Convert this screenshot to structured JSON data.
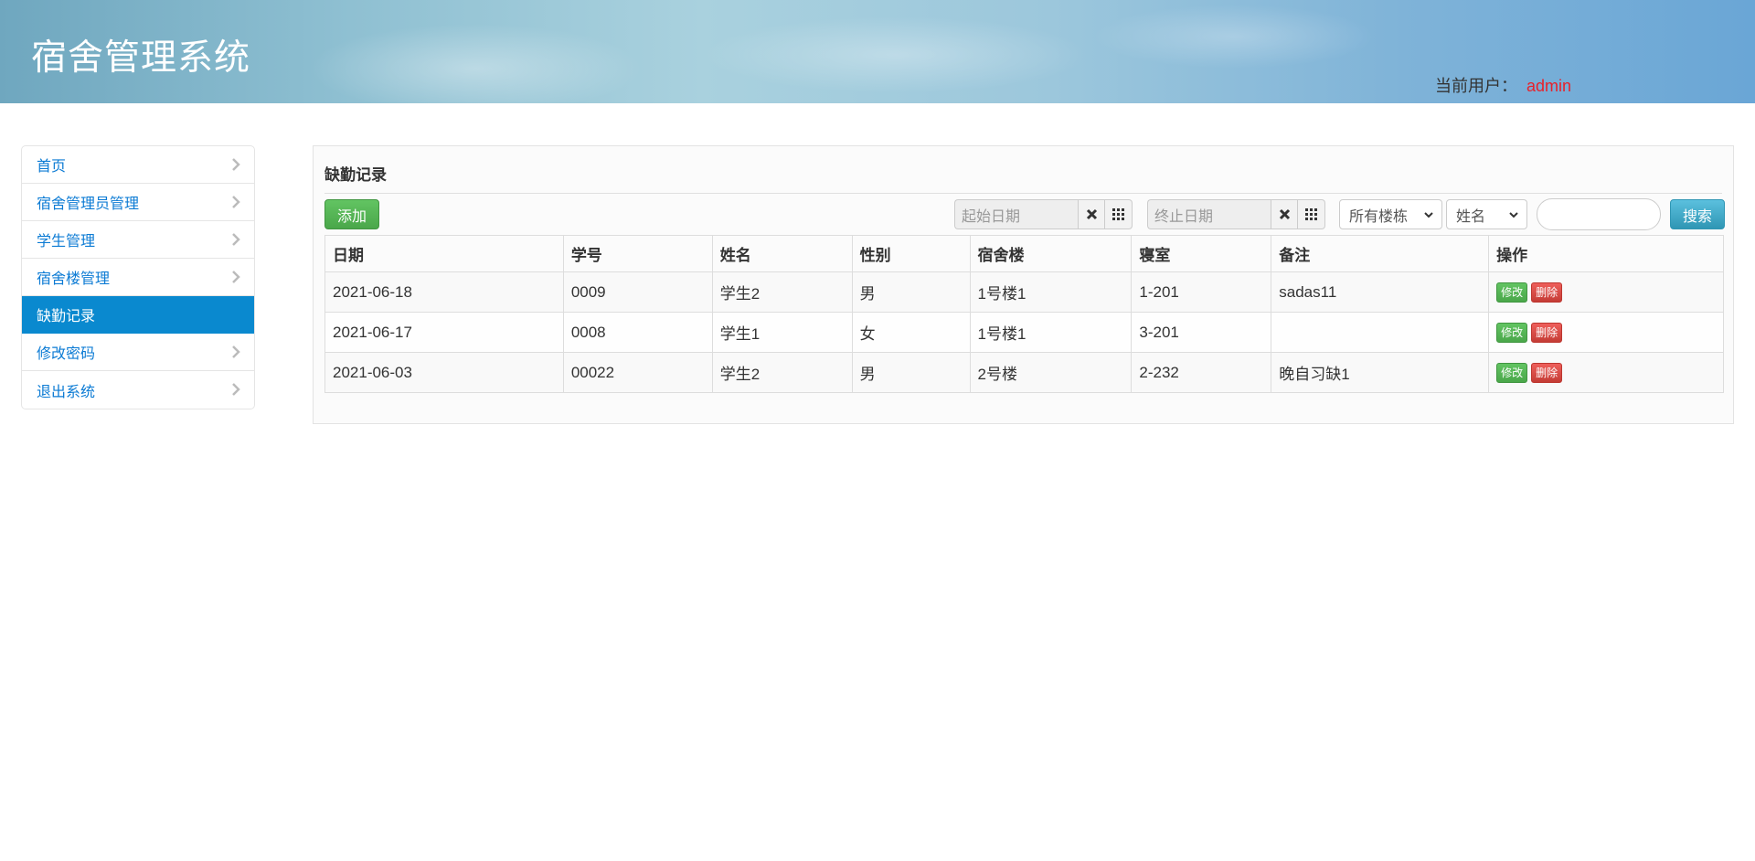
{
  "app": {
    "title": "宿舍管理系统",
    "current_user_label": "当前用户：",
    "current_user": "admin"
  },
  "sidebar": {
    "items": [
      {
        "label": "首页",
        "active": false
      },
      {
        "label": "宿舍管理员管理",
        "active": false
      },
      {
        "label": "学生管理",
        "active": false
      },
      {
        "label": "宿舍楼管理",
        "active": false
      },
      {
        "label": "缺勤记录",
        "active": true
      },
      {
        "label": "修改密码",
        "active": false
      },
      {
        "label": "退出系统",
        "active": false
      }
    ]
  },
  "main": {
    "title": "缺勤记录",
    "toolbar": {
      "add_label": "添加",
      "start_date_placeholder": "起始日期",
      "end_date_placeholder": "终止日期",
      "building_select": "所有楼栋",
      "field_select": "姓名",
      "search_value": "",
      "search_label": "搜索"
    },
    "table": {
      "columns": [
        "日期",
        "学号",
        "姓名",
        "性别",
        "宿舍楼",
        "寝室",
        "备注",
        "操作"
      ],
      "rows": [
        {
          "date": "2021-06-18",
          "student_no": "0009",
          "name": "学生2",
          "gender": "男",
          "building": "1号楼1",
          "room": "1-201",
          "note": "sadas11"
        },
        {
          "date": "2021-06-17",
          "student_no": "0008",
          "name": "学生1",
          "gender": "女",
          "building": "1号楼1",
          "room": "3-201",
          "note": ""
        },
        {
          "date": "2021-06-03",
          "student_no": "00022",
          "name": "学生2",
          "gender": "男",
          "building": "2号楼",
          "room": "2-232",
          "note": "晚自习缺1"
        }
      ],
      "edit_label": "修改",
      "delete_label": "删除"
    }
  },
  "colors": {
    "accent": "#0a89cf",
    "link": "#0c7bd4",
    "user": "#e8212a",
    "success": "#4aa74a",
    "danger": "#c43c35",
    "info": "#2f96b4"
  }
}
